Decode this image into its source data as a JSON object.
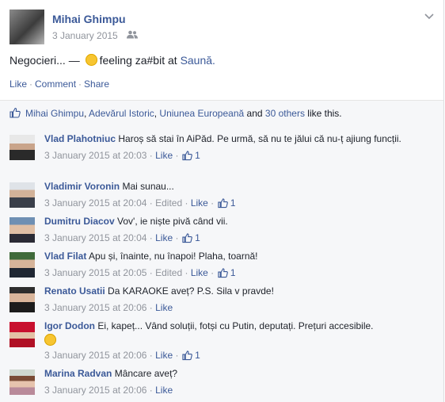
{
  "post": {
    "author": "Mihai Ghimpu",
    "date": "3 January 2015",
    "audience_icon": "friends-icon",
    "status_prefix": "Negocieri... —",
    "feeling_text": "feeling za#bit at",
    "place": "Saună.",
    "actions": {
      "like": "Like",
      "comment": "Comment",
      "share": "Share"
    }
  },
  "likes": {
    "names": [
      "Mihai Ghimpu",
      "Adevărul Istoric",
      "Uniunea Europeană"
    ],
    "and_text": "and",
    "others": "30 others",
    "suffix": "like this."
  },
  "comments": [
    {
      "name": "Vlad Plahotniuc",
      "text": "Haroș să stai în AiPăd. Pe urmă, să nu te jălui că nu-ț ajiung funcții.",
      "time": "3 January 2015 at 20:03",
      "edited": "",
      "like": "Like",
      "count": "1"
    },
    {
      "name": "Vladimir Voronin",
      "text": "Mai sunau...",
      "time": "3 January 2015 at 20:04",
      "edited": "Edited",
      "like": "Like",
      "count": "1"
    },
    {
      "name": "Dumitru Diacov",
      "text": "Vov', ie niște pivă când vii.",
      "time": "3 January 2015 at 20:04",
      "edited": "",
      "like": "Like",
      "count": "1"
    },
    {
      "name": "Vlad Filat",
      "text": "Apu și, înainte, nu înapoi! Plaha, toarnă!",
      "time": "3 January 2015 at 20:05",
      "edited": "Edited",
      "like": "Like",
      "count": "1"
    },
    {
      "name": "Renato Usatii",
      "text": "Da KARAOKE aveț? P.S. Sila v pravde!",
      "time": "3 January 2015 at 20:06",
      "edited": "",
      "like": "Like",
      "count": ""
    },
    {
      "name": "Igor Dodon",
      "text": "Ei, kapeț... Vând soluții, fotși cu Putin, deputați. Prețuri accesibile.",
      "time": "3 January 2015 at 20:06",
      "edited": "",
      "like": "Like",
      "count": "1"
    },
    {
      "name": "Marina Radvan",
      "text": "Mâncare aveț?",
      "time": "3 January 2015 at 20:06",
      "edited": "",
      "like": "Like",
      "count": ""
    }
  ],
  "colors": {
    "link": "#3b5998",
    "meta": "#90949c",
    "panel": "#f6f7f9"
  }
}
